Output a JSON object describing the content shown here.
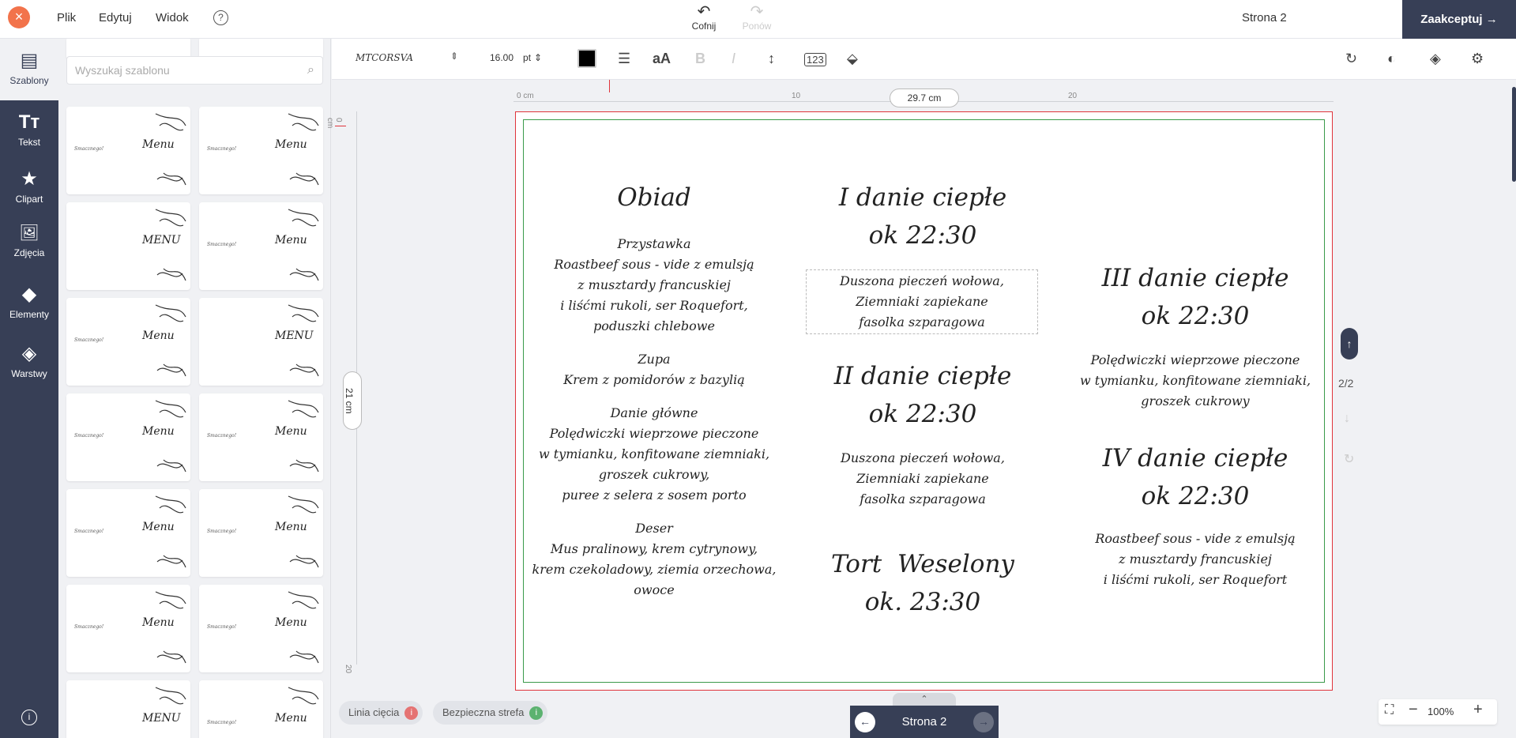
{
  "topbar": {
    "close_icon": "×",
    "menus": [
      "Plik",
      "Edytuj",
      "Widok"
    ],
    "help_icon": "?",
    "undo_label": "Cofnij",
    "redo_label": "Ponów",
    "page_label": "Strona 2",
    "accept_label": "Zaakceptuj →"
  },
  "rail": {
    "items": [
      {
        "label": "Szablony",
        "icon": "▤"
      },
      {
        "label": "Tekst",
        "icon": "Tт"
      },
      {
        "label": "Clipart",
        "icon": "★"
      },
      {
        "label": "Zdjęcia",
        "icon": "🖼"
      },
      {
        "label": "Elementy",
        "icon": "◆"
      },
      {
        "label": "Warstwy",
        "icon": "◈"
      }
    ],
    "info_icon": "i"
  },
  "templates": {
    "search_placeholder": "Wyszukaj szablonu",
    "items": [
      {
        "left": "Smacznego!",
        "title": "Menu"
      },
      {
        "left": "Smacznego!",
        "title": "Menu"
      },
      {
        "left": "",
        "title": "MENU"
      },
      {
        "left": "Smacznego!",
        "title": "Menu"
      },
      {
        "left": "Smacznego!",
        "title": "Menu"
      },
      {
        "left": "",
        "title": "MENU"
      },
      {
        "left": "Smacznego!",
        "title": "Menu"
      },
      {
        "left": "Smacznego!",
        "title": "Menu"
      },
      {
        "left": "Smacznego!",
        "title": "Menu"
      },
      {
        "left": "Smacznego!",
        "title": "Menu"
      },
      {
        "left": "Smacznego!",
        "title": "Menu"
      },
      {
        "left": "Smacznego!",
        "title": "Menu"
      },
      {
        "left": "",
        "title": "MENU"
      },
      {
        "left": "Smacznego!",
        "title": "Menu"
      }
    ]
  },
  "toolbar": {
    "font_name": "MTCORSVA",
    "font_size": "16.00",
    "font_unit": "pt",
    "text_color": "#000000"
  },
  "rulers": {
    "h_ticks": [
      "0 cm",
      "10",
      "20"
    ],
    "h_dim": "29.7 cm",
    "v_ticks": [
      "0 cm",
      "20"
    ],
    "v_dim": "21 cm"
  },
  "menu_card": {
    "col1": {
      "heading": "Obiad",
      "lines": [
        "Przystawka",
        "Roastbeef sous - vide z emulsją",
        "z musztardy francuskiej",
        "i liśćmi rukoli, ser Roquefort,",
        "poduszki chlebowe",
        "",
        "Zupa",
        "Krem z pomidorów z bazylią",
        "",
        "Danie główne",
        "Polędwiczki wieprzowe pieczone",
        "w tymianku, konfitowane ziemniaki,",
        "groszek cukrowy,",
        "puree z selera z sosem porto",
        "",
        "Deser",
        "Mus pralinowy, krem cytrynowy,",
        "krem czekoladowy, ziemia orzechowa,",
        "owoce"
      ]
    },
    "col2": {
      "h1": "I danie ciepłe",
      "h1_time": "ok 22:30",
      "b1": [
        "Duszona pieczeń wołowa,",
        "Ziemniaki zapiekane",
        "fasolka szparagowa"
      ],
      "h2": "II danie ciepłe",
      "h2_time": "ok 22:30",
      "b2": [
        "Duszona pieczeń wołowa,",
        "Ziemniaki zapiekane",
        "fasolka szparagowa"
      ],
      "h3": "Tort  Weselony",
      "h3_time": "ok. 23:30"
    },
    "col3": {
      "h1": "III danie ciepłe",
      "h1_time": "ok 22:30",
      "b1": [
        "Polędwiczki wieprzowe pieczone",
        "w tymianku, konfitowane ziemniaki,",
        "groszek cukrowy"
      ],
      "h2": "IV danie ciepłe",
      "h2_time": "ok 22:30",
      "b2": [
        "Roastbeef sous - vide z emulsją",
        "z musztardy francuskiej",
        "i liśćmi rukoli, ser Roquefort"
      ]
    }
  },
  "side_nav": {
    "counter": "2/2"
  },
  "bottom": {
    "cut_line": "Linia cięcia",
    "safe_zone": "Bezpieczna strefa",
    "pager_label": "Strona 2",
    "zoom_level": "100%"
  },
  "colors": {
    "accent": "#373f56",
    "close": "#f2734b",
    "cut_line": "#e0343b",
    "safe_zone": "#3a9a4a"
  }
}
